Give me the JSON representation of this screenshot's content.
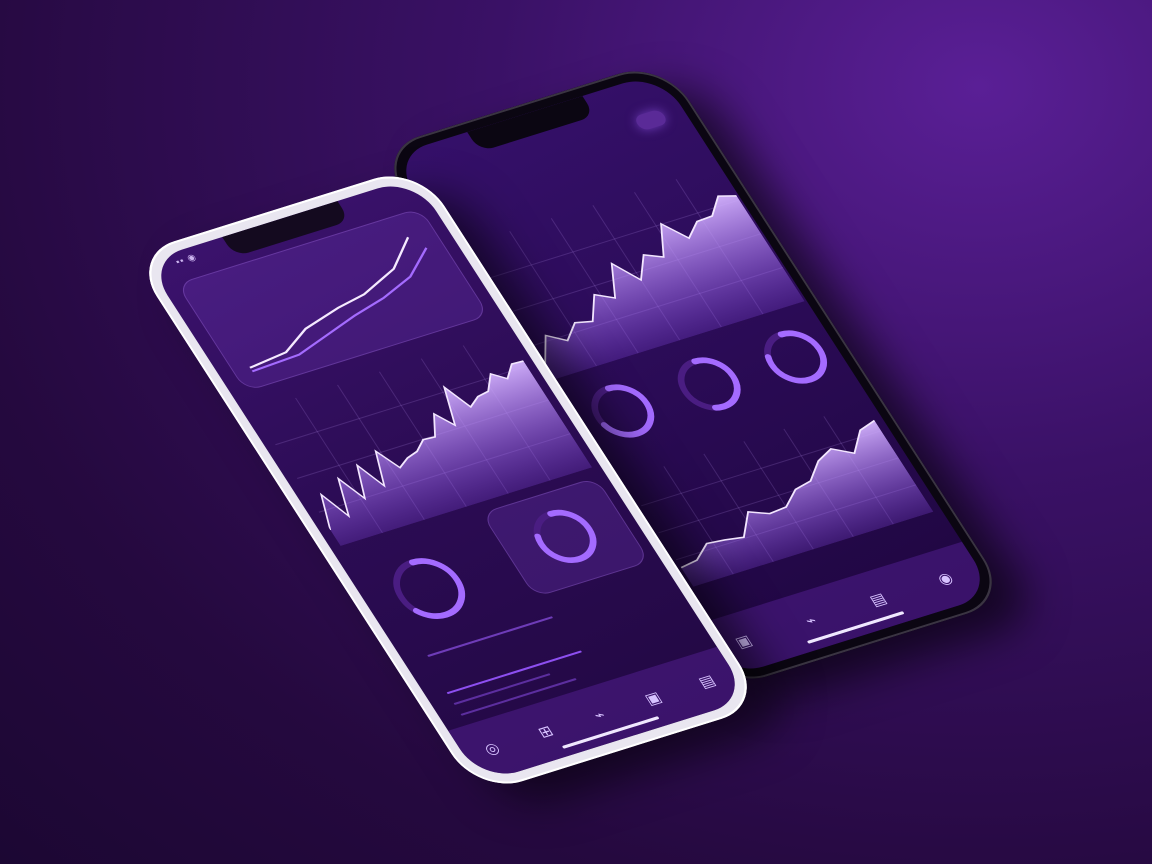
{
  "left_phone": {
    "status": "▪▪ ◉",
    "title": "",
    "subtitle": "",
    "card_caption": "",
    "stat_caption": "",
    "ring": {
      "value": "",
      "fraction": 0.65
    },
    "ring_small": {
      "value": "",
      "fraction": 0.8
    },
    "right_label": "",
    "big_value": "",
    "list_label": "",
    "nav": [
      "◎",
      "⊞",
      "⌁",
      "▣",
      "▤"
    ]
  },
  "right_phone": {
    "status": "",
    "title": "",
    "subtitle": "",
    "subtitle2": "",
    "pill": "",
    "section_label": "",
    "rings": [
      {
        "value": "",
        "fraction": 0.7
      },
      {
        "value": "",
        "fraction": 0.55
      },
      {
        "value": "",
        "fraction": 0.8
      }
    ],
    "mini_label": "",
    "mini_label2": "",
    "nav": [
      "▣",
      "⌁",
      "▤",
      "◉"
    ]
  },
  "colors": {
    "accent": "#a46bff",
    "accent_light": "#d5b4ff",
    "fill": "#8d4ff0",
    "ring_track": "#4a1d82"
  }
}
